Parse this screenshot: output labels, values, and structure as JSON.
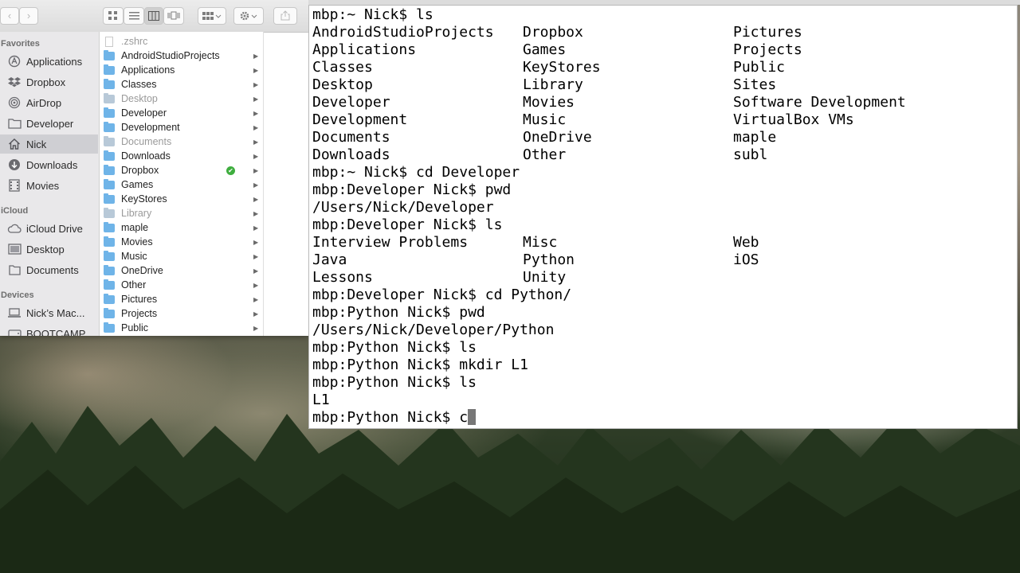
{
  "finder": {
    "toolbar": {
      "back": "‹",
      "forward": "›"
    },
    "sidebar": {
      "favorites_header": "Favorites",
      "favorites": [
        {
          "label": "Applications",
          "icon": "applications-icon"
        },
        {
          "label": "Dropbox",
          "icon": "dropbox-icon"
        },
        {
          "label": "AirDrop",
          "icon": "airdrop-icon"
        },
        {
          "label": "Developer",
          "icon": "folder-icon"
        },
        {
          "label": "Nick",
          "icon": "home-icon",
          "selected": true
        },
        {
          "label": "Downloads",
          "icon": "downloads-icon"
        },
        {
          "label": "Movies",
          "icon": "movies-icon"
        }
      ],
      "icloud_header": "iCloud",
      "icloud": [
        {
          "label": "iCloud Drive",
          "icon": "cloud-icon"
        },
        {
          "label": "Desktop",
          "icon": "desktop-icon"
        },
        {
          "label": "Documents",
          "icon": "documents-icon"
        }
      ],
      "devices_header": "Devices",
      "devices": [
        {
          "label": "Nick’s Mac...",
          "icon": "laptop-icon"
        },
        {
          "label": "BOOTCAMP",
          "icon": "disk-icon"
        }
      ]
    },
    "files": [
      {
        "name": ".zshrc",
        "grey": true,
        "folder": false
      },
      {
        "name": "AndroidStudioProjects"
      },
      {
        "name": "Applications"
      },
      {
        "name": "Classes"
      },
      {
        "name": "Desktop",
        "grey": true
      },
      {
        "name": "Developer"
      },
      {
        "name": "Development"
      },
      {
        "name": "Documents",
        "grey": true
      },
      {
        "name": "Downloads"
      },
      {
        "name": "Dropbox",
        "badge": "✔"
      },
      {
        "name": "Games"
      },
      {
        "name": "KeyStores"
      },
      {
        "name": "Library",
        "grey": true
      },
      {
        "name": "maple"
      },
      {
        "name": "Movies"
      },
      {
        "name": "Music"
      },
      {
        "name": "OneDrive"
      },
      {
        "name": "Other"
      },
      {
        "name": "Pictures"
      },
      {
        "name": "Projects"
      },
      {
        "name": "Public"
      }
    ]
  },
  "terminal": {
    "lines": [
      {
        "text": "mbp:~ Nick$ ls"
      },
      {
        "cols": [
          "AndroidStudioProjects",
          "Dropbox",
          "Pictures"
        ]
      },
      {
        "cols": [
          "Applications",
          "Games",
          "Projects"
        ]
      },
      {
        "cols": [
          "Classes",
          "KeyStores",
          "Public"
        ]
      },
      {
        "cols": [
          "Desktop",
          "Library",
          "Sites"
        ]
      },
      {
        "cols": [
          "Developer",
          "Movies",
          "Software Development"
        ]
      },
      {
        "cols": [
          "Development",
          "Music",
          "VirtualBox VMs"
        ]
      },
      {
        "cols": [
          "Documents",
          "OneDrive",
          "maple"
        ]
      },
      {
        "cols": [
          "Downloads",
          "Other",
          "subl"
        ]
      },
      {
        "text": "mbp:~ Nick$ cd Developer"
      },
      {
        "text": "mbp:Developer Nick$ pwd"
      },
      {
        "text": "/Users/Nick/Developer"
      },
      {
        "text": "mbp:Developer Nick$ ls"
      },
      {
        "cols": [
          "Interview Problems",
          "Misc",
          "Web"
        ]
      },
      {
        "cols": [
          "Java",
          "Python",
          "iOS"
        ]
      },
      {
        "cols": [
          "Lessons",
          "Unity",
          ""
        ]
      },
      {
        "text": "mbp:Developer Nick$ cd Python/"
      },
      {
        "text": "mbp:Python Nick$ pwd"
      },
      {
        "text": "/Users/Nick/Developer/Python"
      },
      {
        "text": "mbp:Python Nick$ ls"
      },
      {
        "text": "mbp:Python Nick$ mkdir L1"
      },
      {
        "text": "mbp:Python Nick$ ls"
      },
      {
        "text": "L1"
      }
    ],
    "prompt": "mbp:Python Nick$ ",
    "current_input": "c"
  }
}
